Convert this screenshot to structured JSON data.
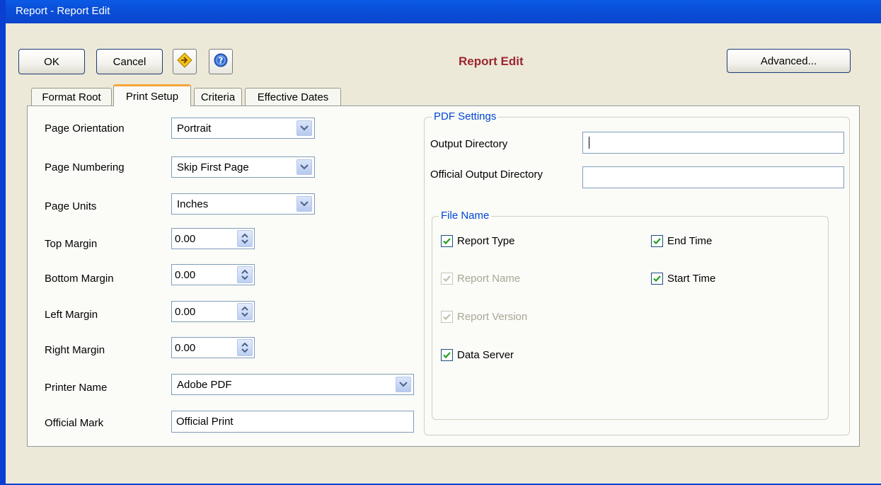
{
  "window": {
    "title": "Report - Report Edit"
  },
  "toolbar": {
    "ok_label": "OK",
    "cancel_label": "Cancel",
    "advanced_label": "Advanced...",
    "form_title": "Report Edit"
  },
  "tabs": [
    {
      "label": "Format Root",
      "active": false
    },
    {
      "label": "Print Setup",
      "active": true
    },
    {
      "label": "Criteria",
      "active": false
    },
    {
      "label": "Effective Dates",
      "active": false
    }
  ],
  "print_setup": {
    "page_orientation": {
      "label": "Page Orientation",
      "value": "Portrait"
    },
    "page_numbering": {
      "label": "Page Numbering",
      "value": "Skip First Page"
    },
    "page_units": {
      "label": "Page Units",
      "value": "Inches"
    },
    "top_margin": {
      "label": "Top Margin",
      "value": "0.00"
    },
    "bottom_margin": {
      "label": "Bottom Margin",
      "value": "0.00"
    },
    "left_margin": {
      "label": "Left Margin",
      "value": "0.00"
    },
    "right_margin": {
      "label": "Right Margin",
      "value": "0.00"
    },
    "printer_name": {
      "label": "Printer Name",
      "value": "Adobe PDF"
    },
    "official_mark": {
      "label": "Official Mark",
      "value": "Official Print"
    }
  },
  "pdf_settings": {
    "legend": "PDF Settings",
    "output_directory": {
      "label": "Output Directory",
      "value": ""
    },
    "official_output_directory": {
      "label": "Official Output Directory",
      "value": ""
    },
    "file_name": {
      "legend": "File Name",
      "report_type": {
        "label": "Report Type",
        "checked": true,
        "enabled": true
      },
      "report_name": {
        "label": "Report Name",
        "checked": true,
        "enabled": false
      },
      "report_version": {
        "label": "Report Version",
        "checked": true,
        "enabled": false
      },
      "data_server": {
        "label": "Data Server",
        "checked": true,
        "enabled": true
      },
      "end_time": {
        "label": "End Time",
        "checked": true,
        "enabled": true
      },
      "start_time": {
        "label": "Start Time",
        "checked": true,
        "enabled": true
      }
    }
  },
  "colors": {
    "title_bar": "#0a4fd8",
    "form_title": "#9b2530",
    "group_legend": "#0046d5",
    "check_mark": "#21a121",
    "active_tab_accent": "#f6a63a",
    "client_bg": "#ece9d8"
  }
}
